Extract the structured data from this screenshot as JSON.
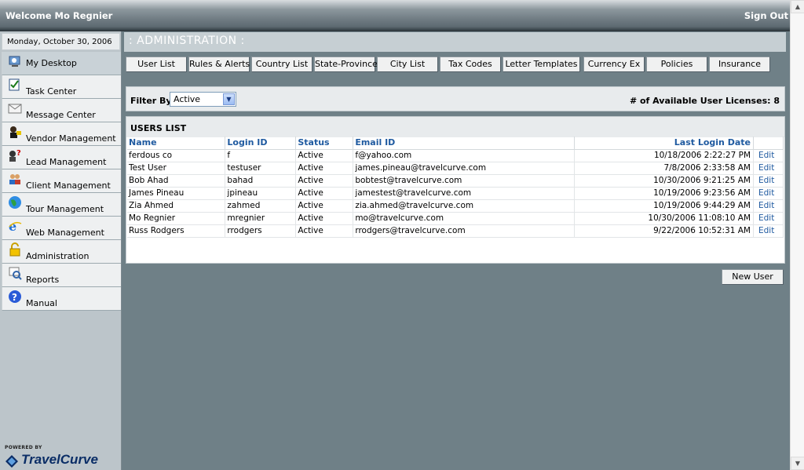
{
  "header": {
    "welcome": "Welcome Mo Regnier",
    "signout": "Sign Out"
  },
  "sidebar": {
    "date": "Monday, October 30, 2006",
    "items": [
      {
        "label": "My Desktop",
        "icon": "desktop-icon"
      },
      {
        "label": "Task Center",
        "icon": "task-icon"
      },
      {
        "label": "Message Center",
        "icon": "message-icon"
      },
      {
        "label": "Vendor Management",
        "icon": "vendor-icon"
      },
      {
        "label": "Lead Management",
        "icon": "lead-icon"
      },
      {
        "label": "Client Management",
        "icon": "client-icon"
      },
      {
        "label": "Tour Management",
        "icon": "globe-icon"
      },
      {
        "label": "Web Management",
        "icon": "web-icon"
      },
      {
        "label": "Administration",
        "icon": "lock-icon"
      },
      {
        "label": "Reports",
        "icon": "reports-icon"
      },
      {
        "label": "Manual",
        "icon": "help-icon"
      }
    ],
    "powered": "POWERED BY",
    "logo": "TravelCurve"
  },
  "main": {
    "title": ": ADMINISTRATION :",
    "tabs": [
      "User List",
      "Rules & Alerts",
      "Country List",
      "State-Province",
      "City List",
      "Tax Codes",
      "Letter Templates",
      "Currency Ex",
      "Policies",
      "Insurance"
    ],
    "filter": {
      "label": "Filter By",
      "value": "Active"
    },
    "licenses": "# of Available User Licenses: 8",
    "users": {
      "title": "USERS LIST",
      "columns": [
        "Name",
        "Login ID",
        "Status",
        "Email ID",
        "Last Login Date"
      ],
      "rows": [
        {
          "name": "ferdous co",
          "login": "f",
          "status": "Active",
          "email": "f@yahoo.com",
          "last": "10/18/2006 2:22:27 PM",
          "action": "Edit"
        },
        {
          "name": "Test User",
          "login": "testuser",
          "status": "Active",
          "email": "james.pineau@travelcurve.com",
          "last": "7/8/2006 2:33:58 AM",
          "action": "Edit"
        },
        {
          "name": "Bob Ahad",
          "login": "bahad",
          "status": "Active",
          "email": "bobtest@travelcurve.com",
          "last": "10/30/2006 9:21:25 AM",
          "action": "Edit"
        },
        {
          "name": "James Pineau",
          "login": "jpineau",
          "status": "Active",
          "email": "jamestest@travelcurve.com",
          "last": "10/19/2006 9:23:56 AM",
          "action": "Edit"
        },
        {
          "name": "Zia Ahmed",
          "login": "zahmed",
          "status": "Active",
          "email": "zia.ahmed@travelcurve.com",
          "last": "10/19/2006 9:44:29 AM",
          "action": "Edit"
        },
        {
          "name": "Mo Regnier",
          "login": "mregnier",
          "status": "Active",
          "email": "mo@travelcurve.com",
          "last": "10/30/2006 11:08:10 AM",
          "action": "Edit"
        },
        {
          "name": "Russ Rodgers",
          "login": "rrodgers",
          "status": "Active",
          "email": "rrodgers@travelcurve.com",
          "last": "9/22/2006 10:52:31 AM",
          "action": "Edit"
        }
      ]
    },
    "new_user": "New User"
  },
  "colors": {
    "header": "#5d6a71",
    "sidebar": "#bcc5ca",
    "main_bg": "#6f8087",
    "link": "#1f5aa0"
  }
}
